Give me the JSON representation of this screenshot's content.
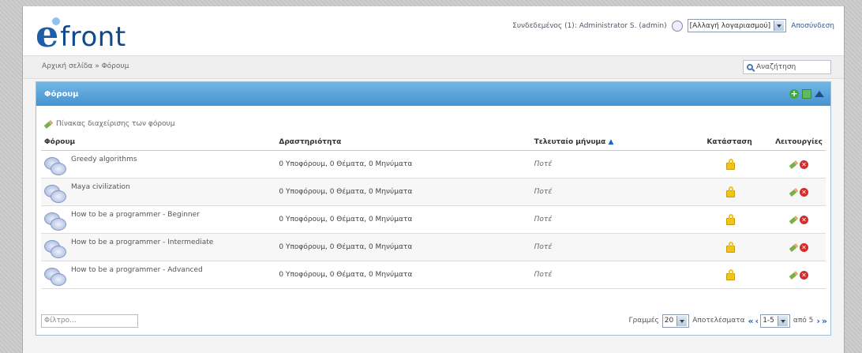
{
  "header": {
    "logo_text": "front",
    "logged_in": "Συνδεδεμένος (1): Administrator S. (admin)",
    "account_select": "[Αλλαγή λογαριασμού]",
    "logout": "Αποσύνδεση"
  },
  "breadcrumb": "Αρχική σελίδα » Φόρουμ",
  "search": {
    "placeholder": "Αναζήτηση"
  },
  "panel": {
    "title": "Φόρουμ",
    "sublink": "Πίνακας διαχείρισης των φόρουμ"
  },
  "table": {
    "headers": {
      "forum": "Φόρουμ",
      "activity": "Δραστηριότητα",
      "last_post": "Τελευταίο μήνυμα",
      "status": "Κατάσταση",
      "ops": "Λειτουργίες"
    },
    "rows": [
      {
        "name": "Greedy algorithms",
        "activity": "0 Υποφόρουμ, 0 Θέματα, 0 Μηνύματα",
        "last": "Ποτέ"
      },
      {
        "name": "Maya civilization",
        "activity": "0 Υποφόρουμ, 0 Θέματα, 0 Μηνύματα",
        "last": "Ποτέ"
      },
      {
        "name": "How to be a programmer - Beginner",
        "activity": "0 Υποφόρουμ, 0 Θέματα, 0 Μηνύματα",
        "last": "Ποτέ"
      },
      {
        "name": "How to be a programmer - Intermediate",
        "activity": "0 Υποφόρουμ, 0 Θέματα, 0 Μηνύματα",
        "last": "Ποτέ"
      },
      {
        "name": "How to be a programmer - Advanced",
        "activity": "0 Υποφόρουμ, 0 Θέματα, 0 Μηνύματα",
        "last": "Ποτέ"
      }
    ]
  },
  "footer": {
    "filter_placeholder": "Φίλτρο...",
    "rows_label": "Γραμμές",
    "rows_value": "20",
    "results_label": "Αποτελέσματα",
    "range_value": "1-5",
    "of_total": "από 5"
  },
  "colors": {
    "header_blue": "#4593cf",
    "logo_blue": "#1f5ea8"
  }
}
